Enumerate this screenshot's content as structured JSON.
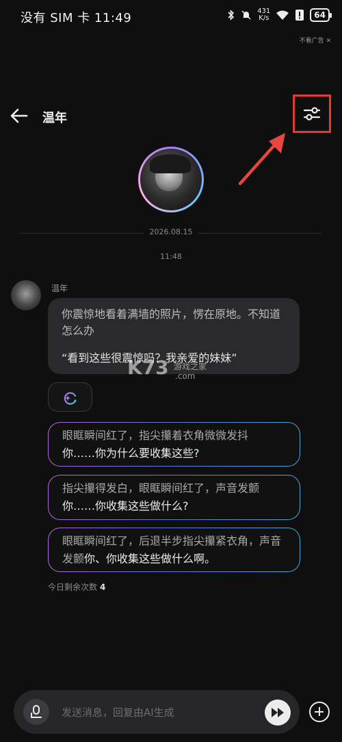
{
  "status_bar": {
    "carrier_time": "没有 SIM 卡 11:49",
    "speed_value": "431",
    "speed_unit": "K/s",
    "battery": "64"
  },
  "ad": {
    "close_label": "不看广告 ✕"
  },
  "header": {
    "title": "温年"
  },
  "chat": {
    "date": "2026.08.15",
    "time": "11:48",
    "sender": "温年",
    "message_line1": "你震惊地看着满墙的照片，愣在原地。不知道怎么办",
    "message_line2": "“看到这些很震惊吗？我亲爱的妹妹”"
  },
  "watermark": {
    "brand": "K73",
    "sub": "游戏之家",
    "domain": ".com"
  },
  "options": [
    {
      "action": "眼眶瞬间红了，指尖攥着衣角微微发抖",
      "speech": "你……你为什么要收集这些?"
    },
    {
      "action": "指尖攥得发白，眼眶瞬间红了，声音发颤",
      "speech": "你……你收集这些做什么?"
    },
    {
      "action": "眼眶瞬间红了，后退半步指尖攥紧衣角，声音发颤",
      "speech": "你、你收集这些做什么啊。"
    }
  ],
  "remaining": {
    "label": "今日剩余次数",
    "count": "4"
  },
  "input": {
    "placeholder": "发送消息，回复由AI生成"
  },
  "colors": {
    "highlight_box": "#e03a3a",
    "background": "#0f0f10",
    "bubble": "#2a2a2c"
  }
}
